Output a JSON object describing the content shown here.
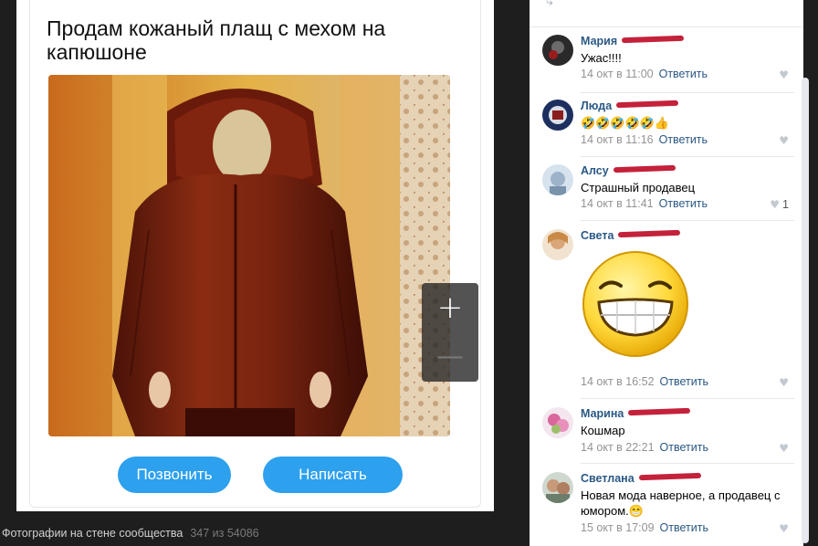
{
  "ad": {
    "title": "Продам кожаный плащ с мехом на капюшоне",
    "call_button": "Позвонить",
    "write_button": "Написать"
  },
  "zoom": {
    "plus": "+",
    "minus": "—"
  },
  "caption": {
    "label": "Фотографии на стене сообщества",
    "counter": "347 из 54086"
  },
  "comments": [
    {
      "author": "Мария",
      "text": "Ужас!!!!",
      "time": "14 окт в 11:00",
      "reply": "Ответить",
      "likes": ""
    },
    {
      "author": "Люда",
      "text": "🤣🤣🤣🤣🤣👍",
      "time": "14 окт в 11:16",
      "reply": "Ответить",
      "likes": ""
    },
    {
      "author": "Алсу",
      "text": "Страшный продавец",
      "time": "14 окт в 11:41",
      "reply": "Ответить",
      "likes": "1"
    },
    {
      "author": "Света",
      "text": "",
      "time": "14 окт в 16:52",
      "reply": "Ответить",
      "likes": ""
    },
    {
      "author": "Марина",
      "text": "Кошмар",
      "time": "14 окт в 22:21",
      "reply": "Ответить",
      "likes": ""
    },
    {
      "author": "Светлана",
      "text": "Новая мода наверное, а продавец с юмором.😁",
      "time": "15 окт в 17:09",
      "reply": "Ответить",
      "likes": ""
    }
  ],
  "colors": {
    "accent": "#2a5885",
    "button": "#2da0ee",
    "redaction": "#c4213b"
  }
}
